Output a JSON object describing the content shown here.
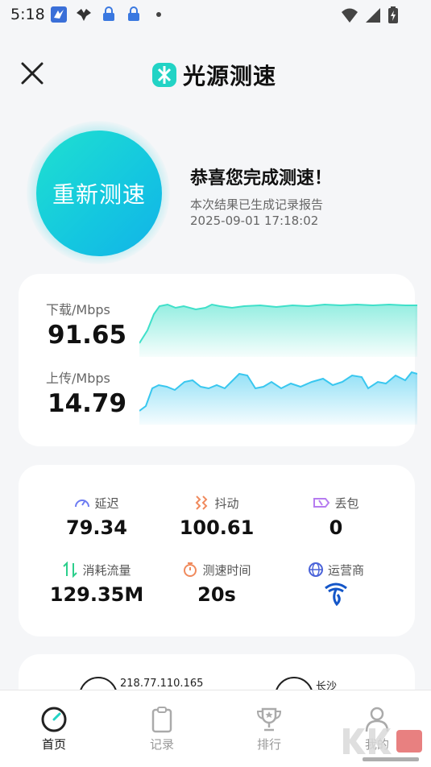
{
  "status_bar": {
    "time": "5:18",
    "icons": [
      "app-notification-icon",
      "bird-notification-icon",
      "lock-notification-icon",
      "lock-notification-icon",
      "more-dot-icon"
    ],
    "right_icons": [
      "wifi-icon",
      "signal-icon",
      "battery-icon"
    ]
  },
  "header": {
    "brand_name": "光源测速",
    "logo_color": "#22d3c5"
  },
  "result": {
    "retest_label": "重新测速",
    "congrats": "恭喜您完成测速！",
    "report_note": "本次结果已生成记录报告",
    "report_time": "2025-09-01 17:18:02"
  },
  "speed": {
    "download_label": "下载/Mbps",
    "download_value": "91.65",
    "upload_label": "上传/Mbps",
    "upload_value": "14.79",
    "download_color": "#3fe0c9",
    "upload_color": "#39c7ef"
  },
  "stats": {
    "latency_label": "延迟",
    "latency_value": "79.34",
    "jitter_label": "抖动",
    "jitter_value": "100.61",
    "loss_label": "丢包",
    "loss_value": "0",
    "traffic_label": "消耗流量",
    "traffic_value": "129.35M",
    "duration_label": "测速时间",
    "duration_value": "20s",
    "carrier_label": "运营商"
  },
  "info": {
    "ip": "218.77.110.165",
    "city": "长沙"
  },
  "nav": {
    "home": "首页",
    "records": "记录",
    "ranking": "排行",
    "mine": "我的"
  },
  "watermark": "KK下载 www.kkx.net"
}
